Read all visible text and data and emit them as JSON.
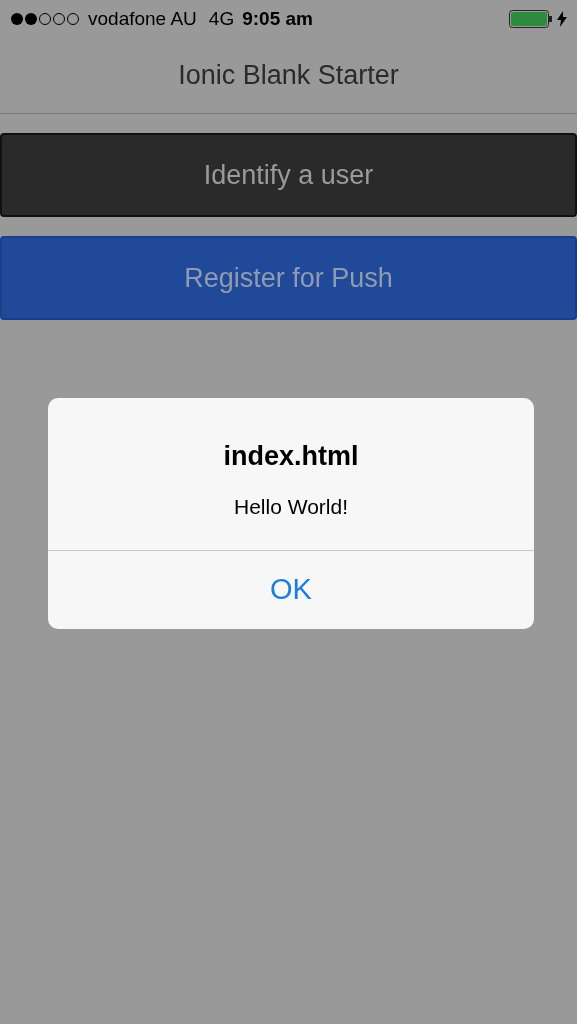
{
  "status_bar": {
    "carrier": "vodafone AU",
    "network": "4G",
    "time": "9:05 am"
  },
  "header": {
    "title": "Ionic Blank Starter"
  },
  "buttons": [
    {
      "label": "Identify a user",
      "kind": "dark"
    },
    {
      "label": "Register for Push",
      "kind": "positive"
    }
  ],
  "alert": {
    "title": "index.html",
    "message": "Hello World!",
    "buttons": [
      "OK"
    ]
  }
}
